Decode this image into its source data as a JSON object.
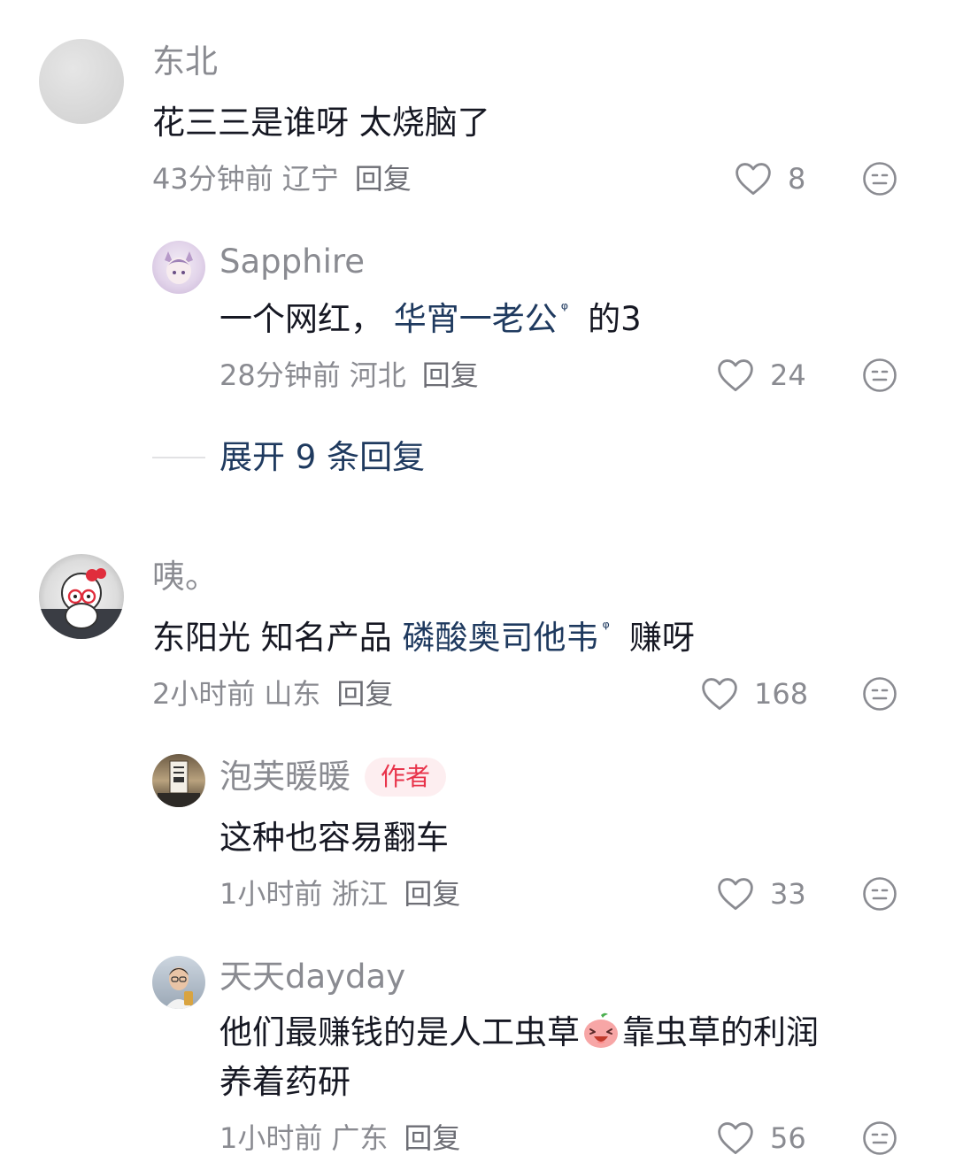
{
  "comments": [
    {
      "username": "东北",
      "content": "花三三是谁呀  太烧脑了",
      "time": "43分钟前",
      "location": "辽宁",
      "reply_label": "回复",
      "likes": "8",
      "replies": [
        {
          "username": "Sapphire",
          "content_prefix": "一个网红，",
          "link": "华宵一老公",
          "content_suffix": "的3",
          "time": "28分钟前",
          "location": "河北",
          "reply_label": "回复",
          "likes": "24"
        }
      ],
      "expand_label": "展开 9 条回复"
    },
    {
      "username": "咦。",
      "content_prefix": "东阳光  知名产品 ",
      "link": "磷酸奥司他韦",
      "content_suffix": "赚呀",
      "time": "2小时前",
      "location": "山东",
      "reply_label": "回复",
      "likes": "168",
      "replies": [
        {
          "username": "泡芙暖暖",
          "badge": "作者",
          "content": "这种也容易翻车",
          "time": "1小时前",
          "location": "浙江",
          "reply_label": "回复",
          "likes": "33"
        },
        {
          "username": "天天dayday",
          "content_line1_prefix": "他们最赚钱的是人工虫草",
          "content_line1_suffix": "靠虫草的利润",
          "content_line2": "养着药研",
          "emoji": "laughing-peach-emoji",
          "time": "1小时前",
          "location": "广东",
          "reply_label": "回复",
          "likes": "56"
        }
      ]
    }
  ],
  "icons": {
    "like": "heart-outline-icon",
    "dislike": "neutral-face-icon",
    "search_mark": "search-small-icon"
  },
  "colors": {
    "link": "#1f3a5f",
    "author_badge_text": "#e8334a",
    "author_badge_bg": "#fdeef0",
    "meta": "#8a8b91"
  }
}
